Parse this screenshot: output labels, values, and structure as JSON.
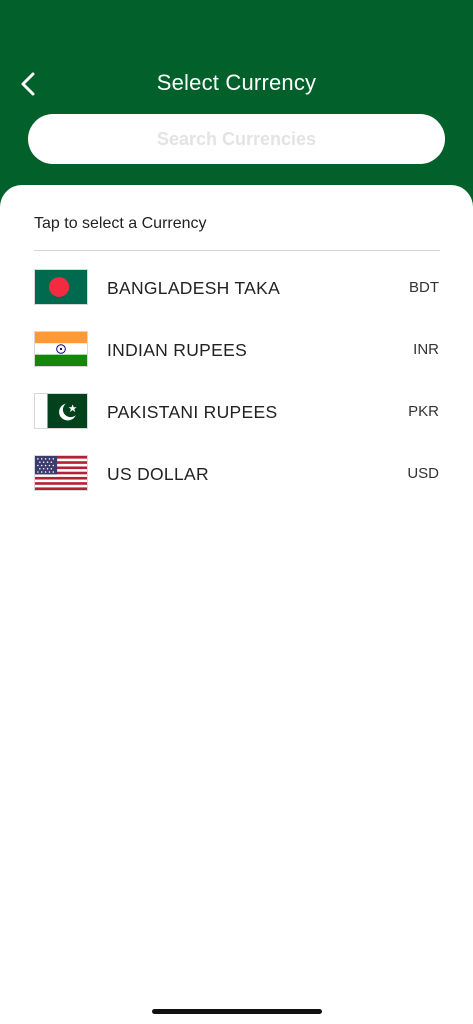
{
  "header": {
    "title": "Select Currency",
    "back_icon": "chevron-left-icon",
    "background_color": "#02602a"
  },
  "search": {
    "placeholder": "Search Currencies",
    "value": ""
  },
  "list": {
    "hint": "Tap to select a Currency",
    "currencies": [
      {
        "name": "BANGLADESH TAKA",
        "code": "BDT",
        "flag": "bangladesh-flag-icon"
      },
      {
        "name": "INDIAN RUPEES",
        "code": "INR",
        "flag": "india-flag-icon"
      },
      {
        "name": "PAKISTANI RUPEES",
        "code": "PKR",
        "flag": "pakistan-flag-icon"
      },
      {
        "name": "US DOLLAR",
        "code": "USD",
        "flag": "usa-flag-icon"
      }
    ]
  }
}
